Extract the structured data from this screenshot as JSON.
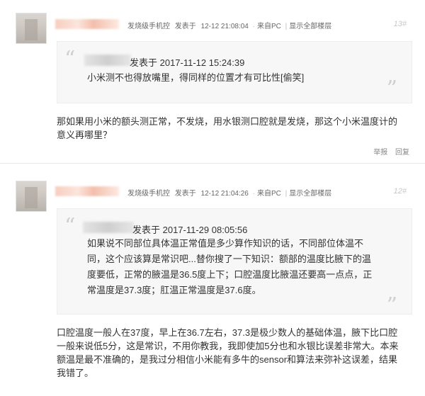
{
  "posts": [
    {
      "device": "发烧级手机控",
      "posted_label": "发表于",
      "time": "12-12 21:08:04",
      "source": "来自PC",
      "show_all": "显示全部楼层",
      "floor": "13#",
      "quote": {
        "time": "发表于 2017-11-12 15:24:39",
        "text": "小米测不也得放嘴里，得同样的位置才有可比性[偷笑]"
      },
      "reply_lines": [
        "那如果用小米的额头测正常，不发烧，用水银测口腔就是发烧，那这个小米温度计的",
        "意义再哪里？"
      ],
      "actions": [
        "举报",
        "回复"
      ]
    },
    {
      "device": "发烧级手机控",
      "posted_label": "发表于",
      "time": "12-12 21:04:26",
      "source": "来自PC",
      "show_all": "显示全部楼层",
      "floor": "12#",
      "quote": {
        "time": "发表于 2017-11-29 08:05:56",
        "text_lines": [
          "如果说不同部位具体温正常值是多少算作知识的话，不同部位体温不",
          "同，这个应该算是常识吧...替你搜了一下知识：额部的温度比腋下的温",
          "度要低，正常的腋温是36.5度上下；口腔温度比腋温还要高一点点，正",
          "常温度是37.3度；肛温正常温度是37.6度。"
        ]
      },
      "reply_lines": [
        "口腔温度一般人在37度，早上在36.7左右，37.3是极少数人的基础体温，腋下比口腔",
        "一般来说低5分，这是常识，不用你教我，我即使加5分也和水银比误差非常大。本来",
        "额温是最不准确的，是我过分相信小米能有多牛的sensor和算法来弥补这误差，结果",
        "我错了。"
      ]
    }
  ]
}
